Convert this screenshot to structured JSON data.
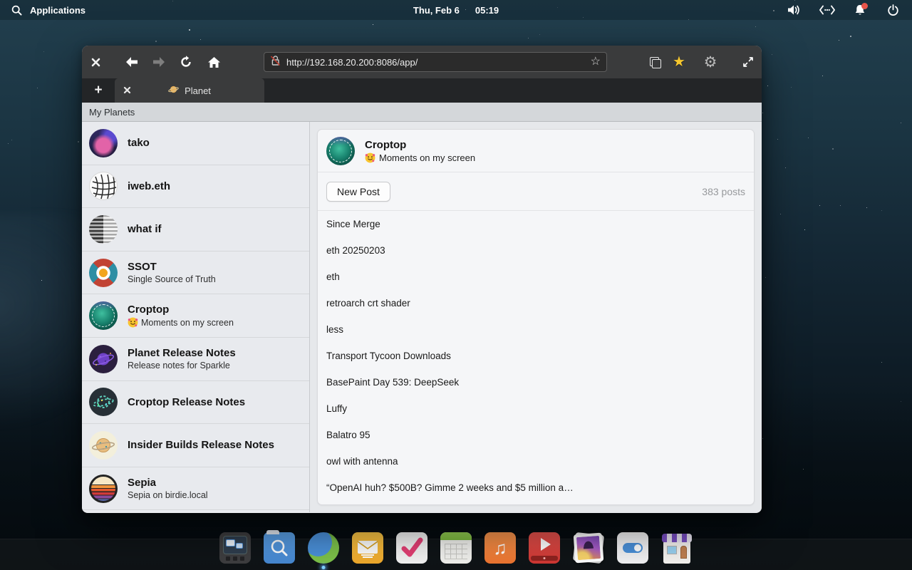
{
  "topbar": {
    "applications_label": "Applications",
    "date": "Thu, Feb 6",
    "time": "05:19",
    "icons": [
      "search-icon",
      "volume-icon",
      "network-icon",
      "notifications-bell-icon",
      "power-icon"
    ],
    "notification_dot_color": "#e8544a"
  },
  "browser": {
    "url": "http://192.168.20.200:8086/app/",
    "toolbar_icons": [
      "close",
      "back",
      "forward",
      "reload",
      "home",
      "insecure-lock",
      "bookmark-star",
      "copy-tabs",
      "favorites-star",
      "settings-gear",
      "fullscreen"
    ],
    "favorites_star_color": "#f6c72e",
    "tab": {
      "title": "Planet",
      "favicon": "saturn-planet"
    },
    "new_tab_label": "+"
  },
  "app": {
    "header": "My Planets",
    "sidebar": [
      {
        "name": "tako",
        "subtitle": ""
      },
      {
        "name": "iweb.eth",
        "subtitle": ""
      },
      {
        "name": "what if",
        "subtitle": ""
      },
      {
        "name": "SSOT",
        "subtitle": "Single Source of Truth"
      },
      {
        "name": "Croptop",
        "emoji": "🥰",
        "subtitle": "Moments on my screen"
      },
      {
        "name": "Planet Release Notes",
        "subtitle": "Release notes for Sparkle"
      },
      {
        "name": "Croptop Release Notes",
        "subtitle": ""
      },
      {
        "name": "Insider Builds Release Notes",
        "subtitle": ""
      },
      {
        "name": "Sepia",
        "subtitle": "Sepia on birdie.local"
      }
    ],
    "main": {
      "title": "Croptop",
      "emoji": "🥰",
      "subtitle": "Moments on my screen",
      "new_post_label": "New Post",
      "post_count": "383 posts",
      "posts": [
        "Since Merge",
        "eth 20250203",
        "eth",
        "retroarch crt shader",
        "less",
        "Transport Tycoon Downloads",
        "BasePaint Day 539: DeepSeek",
        "Luffy",
        "Balatro 95",
        "owl with antenna",
        "“OpenAI huh? $500B? Gimme 2 weeks and $5 million a…"
      ]
    }
  },
  "dock": {
    "items": [
      "multitasking-view",
      "file-search",
      "web-browser",
      "mail",
      "tasks",
      "calendar",
      "music",
      "videos",
      "photos",
      "settings-toggles",
      "app-store"
    ],
    "running": "web-browser"
  }
}
